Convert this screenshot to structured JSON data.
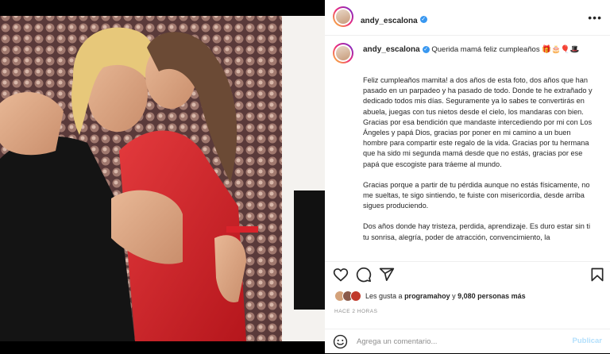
{
  "post": {
    "username": "andy_escalona",
    "more_label": "•••",
    "caption_title": "Querida mamá feliz cumpleaños 🎁🎂🎈🎩",
    "paragraphs": [
      "Feliz cumpleaños mamita! a dos años de esta foto, dos años que han pasado en un parpadeo y ha pasado de todo. Donde te he extrañado y dedicado todos mis días. Seguramente ya lo sabes te convertirás en abuela, juegas con tus nietos desde el cielo, los mandaras con bien. Gracias por esa bendición que mandaste intercediendo por mi con Los Ángeles y papá Dios, gracias por poner en mi camino a un buen hombre para compartir este regalo de la vida. Gracias por tu hermana que ha sido mi segunda mamá desde que no estás, gracias por ese papá que escogiste para tráeme al mundo.",
      "Gracias porque a partir de tu pérdida aunque no estás físicamente, no me sueltas, te sigo sintiendo, te fuiste con misericordia, desde arriba sigues produciendo.",
      "Dos años donde hay tristeza, perdida, aprendizaje. Es duro estar sin ti tu sonrisa, alegría, poder de atracción, convencimiento, la"
    ],
    "likes": {
      "prefix": "Les gusta a",
      "user": "programahoy",
      "joiner": "y",
      "count": "9,080 personas más"
    },
    "time_ago": "HACE 2 HORAS",
    "comment": {
      "placeholder": "Agrega un comentario...",
      "publish_label": "Publicar"
    }
  },
  "colors": {
    "verified": "#3897f0",
    "publish_disabled": "#b2dffc",
    "dress": "#d9232b"
  },
  "icons": [
    "verified-badge-icon",
    "more-options-icon",
    "heart-icon",
    "comment-icon",
    "share-icon",
    "bookmark-icon",
    "emoji-icon"
  ]
}
